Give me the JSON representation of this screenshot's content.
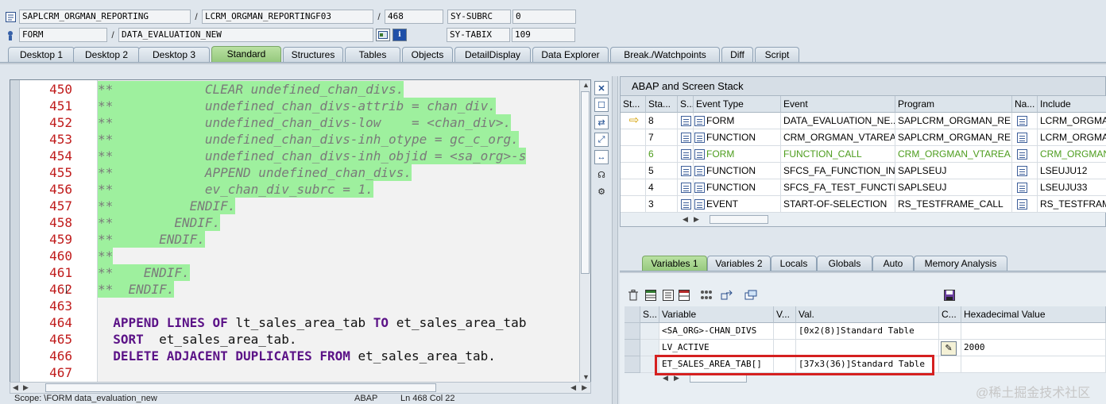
{
  "header": {
    "row1": {
      "program": "SAPLCRM_ORGMAN_REPORTING",
      "include": "LCRM_ORGMAN_REPORTINGF03",
      "line": "468",
      "sysvar_name": "SY-SUBRC",
      "sysvar_value": "0"
    },
    "row2": {
      "event_type": "FORM",
      "event_name": "DATA_EVALUATION_NEW",
      "sysvar_name": "SY-TABIX",
      "sysvar_value": "109"
    }
  },
  "tabs": [
    {
      "label": "Desktop 1"
    },
    {
      "label": "Desktop 2"
    },
    {
      "label": "Desktop 3"
    },
    {
      "label": "Standard",
      "active": true
    },
    {
      "label": "Structures"
    },
    {
      "label": "Tables"
    },
    {
      "label": "Objects"
    },
    {
      "label": "DetailDisplay"
    },
    {
      "label": "Data Explorer"
    },
    {
      "label": "Break./Watchpoints"
    },
    {
      "label": "Diff"
    },
    {
      "label": "Script"
    }
  ],
  "editor": {
    "lines": [
      {
        "no": "450",
        "text": "**            CLEAR undefined_chan_divs.",
        "type": "comment"
      },
      {
        "no": "451",
        "text": "**            undefined_chan_divs-attrib = chan_div.",
        "type": "comment"
      },
      {
        "no": "452",
        "text": "**            undefined_chan_divs-low    = <chan_div>.",
        "type": "comment"
      },
      {
        "no": "453",
        "text": "**            undefined_chan_divs-inh_otype = gc_c_org.",
        "type": "comment"
      },
      {
        "no": "454",
        "text": "**            undefined_chan_divs-inh_objid = <sa_org>-s",
        "type": "comment"
      },
      {
        "no": "455",
        "text": "**            APPEND undefined_chan_divs.",
        "type": "comment"
      },
      {
        "no": "456",
        "text": "**            ev_chan_div_subrc = 1.",
        "type": "comment"
      },
      {
        "no": "457",
        "text": "**          ENDIF.",
        "type": "comment"
      },
      {
        "no": "458",
        "text": "**        ENDIF.",
        "type": "comment"
      },
      {
        "no": "459",
        "text": "**      ENDIF.",
        "type": "comment"
      },
      {
        "no": "460",
        "text": "**",
        "type": "comment"
      },
      {
        "no": "461",
        "text": "**    ENDIF.",
        "type": "comment"
      },
      {
        "no": "462",
        "text": "**  ENDIF.",
        "type": "comment"
      },
      {
        "no": "463",
        "text": "",
        "type": "blank"
      },
      {
        "no": "464",
        "parts": [
          {
            "t": "  APPEND LINES OF ",
            "k": true
          },
          {
            "t": "lt_sales_area_tab ",
            "k": false
          },
          {
            "t": "TO ",
            "k": true
          },
          {
            "t": "et_sales_area_tab",
            "k": false
          }
        ],
        "type": "code"
      },
      {
        "no": "465",
        "parts": [
          {
            "t": "  SORT  ",
            "k": true
          },
          {
            "t": "et_sales_area_tab.",
            "k": false
          }
        ],
        "type": "code"
      },
      {
        "no": "466",
        "parts": [
          {
            "t": "  DELETE ADJACENT DUPLICATES FROM ",
            "k": true
          },
          {
            "t": "et_sales_area_tab.",
            "k": false
          }
        ],
        "type": "code"
      },
      {
        "no": "467",
        "text": "",
        "type": "blank"
      }
    ]
  },
  "status": {
    "scope": "Scope: \\FORM data_evaluation_new",
    "lang": "ABAP",
    "pos": "Ln 468 Col 22"
  },
  "stack": {
    "title": "ABAP and Screen Stack",
    "columns": [
      "St...",
      "Sta...",
      "S...",
      "Event Type",
      "Event",
      "Program",
      "Na...",
      "Include"
    ],
    "rows": [
      {
        "level": "8",
        "event_type": "FORM",
        "event": "DATA_EVALUATION_NE...",
        "program": "SAPLCRM_ORGMAN_REP...",
        "include": "LCRM_ORGMAN",
        "current": true
      },
      {
        "level": "7",
        "event_type": "FUNCTION",
        "event": "CRM_ORGMAN_VTAREA...",
        "program": "SAPLCRM_ORGMAN_REP...",
        "include": "LCRM_ORGMAN"
      },
      {
        "level": "6",
        "event_type": "FORM",
        "event": "FUNCTION_CALL",
        "program": "CRM_ORGMAN_VTAREA...",
        "include": "CRM_ORGMAN_",
        "green": true
      },
      {
        "level": "5",
        "event_type": "FUNCTION",
        "event": "SFCS_FA_FUNCTION_IN...",
        "program": "SAPLSEUJ",
        "include": "LSEUJU12"
      },
      {
        "level": "4",
        "event_type": "FUNCTION",
        "event": "SFCS_FA_TEST_FUNCTI...",
        "program": "SAPLSEUJ",
        "include": "LSEUJU33"
      },
      {
        "level": "3",
        "event_type": "EVENT",
        "event": "START-OF-SELECTION",
        "program": "RS_TESTFRAME_CALL",
        "include": "RS_TESTFRAME"
      }
    ]
  },
  "var_tabs": [
    {
      "label": "Variables 1",
      "active": true
    },
    {
      "label": "Variables 2"
    },
    {
      "label": "Locals"
    },
    {
      "label": "Globals"
    },
    {
      "label": "Auto"
    },
    {
      "label": "Memory Analysis"
    }
  ],
  "vars": {
    "columns": [
      "S...",
      "Variable",
      "V...",
      "Val.",
      "C...",
      "Hexadecimal Value"
    ],
    "rows": [
      {
        "variable": "<SA_ORG>-CHAN_DIVS",
        "value": "[0x2(8)]Standard Table",
        "hex": ""
      },
      {
        "variable": "LV_ACTIVE",
        "value": "",
        "hex": "2000",
        "edit": true
      },
      {
        "variable": "ET_SALES_AREA_TAB[]",
        "value": "[37x3(36)]Standard Table",
        "hex": ""
      }
    ]
  },
  "watermark": "@稀土掘金技术社区",
  "colors": {
    "comment_bg": "#9ef09e",
    "keyword": "#5b1287",
    "line_number": "#c01b1b",
    "active_tab": "#94c77b",
    "highlight": "#d52020"
  }
}
